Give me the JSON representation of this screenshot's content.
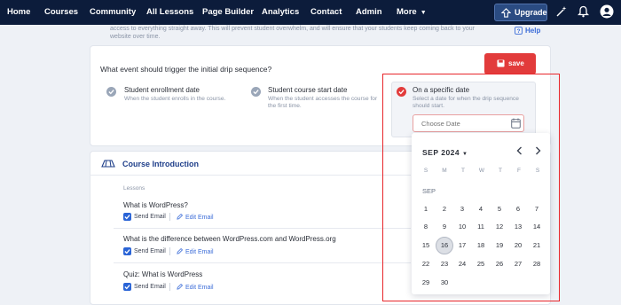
{
  "nav": {
    "items": [
      "Home",
      "Courses",
      "Community",
      "All Lessons",
      "Page Builder",
      "Analytics",
      "Contact",
      "Admin",
      "More"
    ],
    "upgrade_label": "Upgrade"
  },
  "intro": {
    "text": "access to everything straight away. This will prevent student overwhelm, and will ensure that your students keep coming back to your website over time.",
    "help_label": "Help"
  },
  "drip": {
    "save_label": "save",
    "question": "What event should trigger the initial drip sequence?",
    "options": [
      {
        "title": "Student enrollment date",
        "desc": "When the student enrolls in the course."
      },
      {
        "title": "Student course start date",
        "desc": "When the student accesses the course for the first time."
      },
      {
        "title": "On a specific date",
        "desc": "Select a date for when the drip sequence should start."
      }
    ],
    "date_placeholder": "Choose Date"
  },
  "course": {
    "title": "Course Introduction",
    "lessons_label": "Lessons",
    "send_email_label": "Send Email",
    "edit_email_label": "Edit Email",
    "lessons": [
      "What is WordPress?",
      "What is the difference between WordPress.com and WordPress.org",
      "Quiz: What is WordPress"
    ]
  },
  "calendar": {
    "month_label": "SEP 2024",
    "sub_month": "SEP",
    "weekdays": [
      "S",
      "M",
      "T",
      "W",
      "T",
      "F",
      "S"
    ],
    "days": [
      1,
      2,
      3,
      4,
      5,
      6,
      7,
      8,
      9,
      10,
      11,
      12,
      13,
      14,
      15,
      16,
      17,
      18,
      19,
      20,
      21,
      22,
      23,
      24,
      25,
      26,
      27,
      28,
      29,
      30
    ],
    "selected_day": 16
  },
  "colors": {
    "nav_bg": "#0c1c3b",
    "accent_red": "#e23b3b",
    "link_blue": "#3b6cd8",
    "highlight": "#e8262b"
  }
}
